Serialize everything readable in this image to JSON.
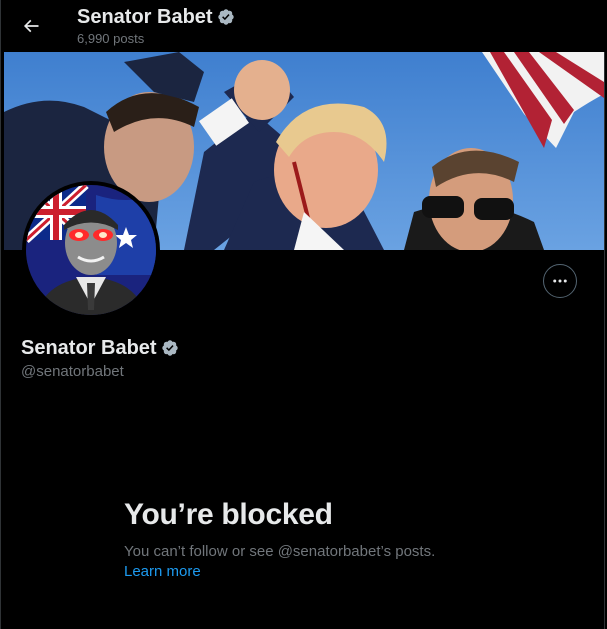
{
  "header": {
    "title": "Senator Babet",
    "subtitle": "6,990 posts",
    "back_icon": "arrow-left-icon",
    "verified_icon": "verified-badge-icon"
  },
  "banner": {
    "description_icon": "banner-photo"
  },
  "profile": {
    "name": "Senator Babet",
    "handle": "@senatorbabet",
    "more_icon": "more-horizontal-icon"
  },
  "blocked": {
    "title": "You’re blocked",
    "description": "You can’t follow or see @senatorbabet’s posts.",
    "link": "Learn more"
  },
  "colors": {
    "background": "#000000",
    "text_primary": "#e7e9ea",
    "text_secondary": "#71767b",
    "link": "#1d9bf0",
    "verified": "#aab8c2"
  }
}
